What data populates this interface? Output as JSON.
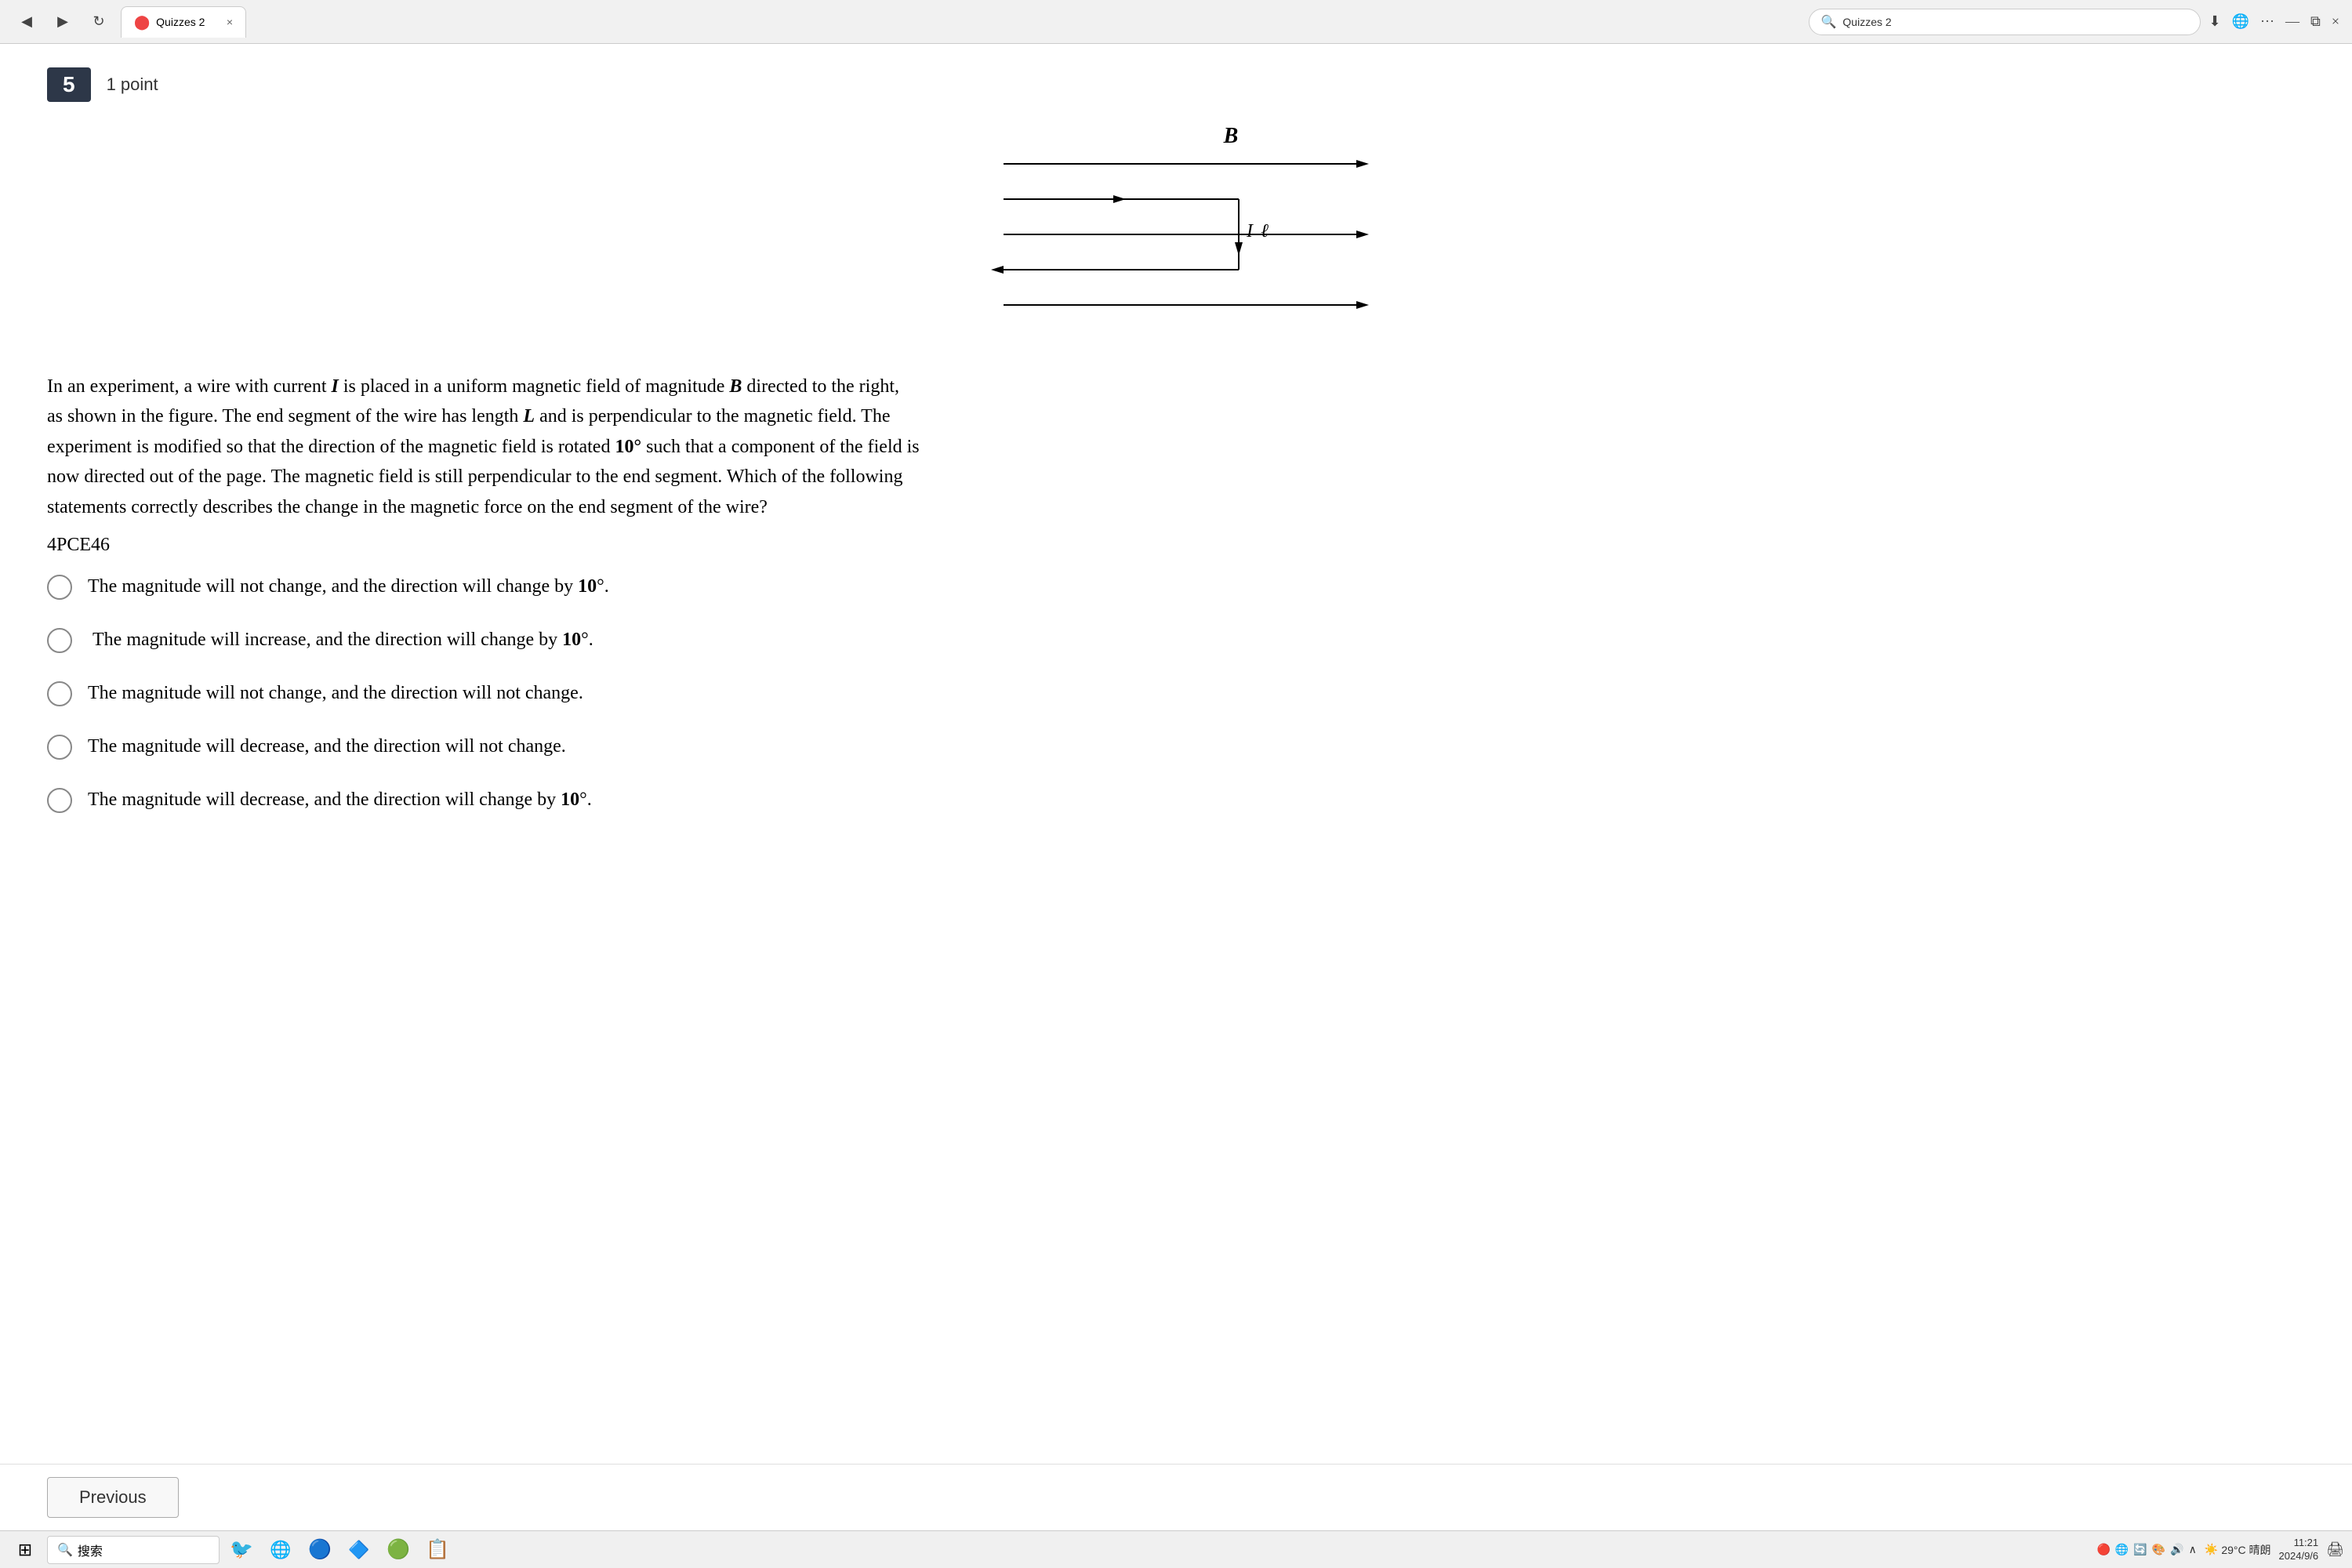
{
  "browser": {
    "back_label": "◀",
    "forward_label": "▶",
    "refresh_label": "↻",
    "tab_title": "Quizzes 2",
    "tab_favicon": "🔴",
    "tab_close": "×",
    "search_url": "Quizzes 2",
    "search_icon": "🔍",
    "right_icons": [
      "⬇",
      "🌐",
      "···",
      "—",
      "⧉",
      "×"
    ]
  },
  "question": {
    "number": "5",
    "points": "1 point",
    "code": "4PCE46",
    "text_line1": "In an experiment, a wire with current ",
    "text_I": "I",
    "text_line1b": " is placed in a uniform magnetic field of magnitude ",
    "text_B": "B",
    "text_line1c": " directed to the right,",
    "text_line2": "as shown in the figure. The end segment of the wire has length ",
    "text_L": "L",
    "text_line2b": " and is perpendicular to the magnetic field. The",
    "text_line3": "experiment is modified so that the direction of the magnetic field is rotated ",
    "text_10a": "10°",
    "text_line3b": " such that a component of the field is",
    "text_line4": "now directed out of the page. The magnetic field is still perpendicular to the end segment. Which of the following",
    "text_line5": "statements correctly describes the change in the magnetic force on the end segment of the wire?"
  },
  "options": [
    {
      "id": "A",
      "text_prefix": "The magnitude will not change, and the direction will change by ",
      "text_bold": "10",
      "text_suffix": "°."
    },
    {
      "id": "B",
      "text_prefix": " The magnitude will increase, and the direction will change by ",
      "text_bold": "10",
      "text_suffix": "°."
    },
    {
      "id": "C",
      "text_prefix": "The magnitude will not change, and the direction will not change.",
      "text_bold": "",
      "text_suffix": ""
    },
    {
      "id": "D",
      "text_prefix": "The magnitude will decrease, and the direction will not change.",
      "text_bold": "",
      "text_suffix": ""
    },
    {
      "id": "E",
      "text_prefix": "The magnitude will decrease, and the direction will change by ",
      "text_bold": "10",
      "text_suffix": "°."
    }
  ],
  "navigation": {
    "previous_label": "Previous"
  },
  "taskbar": {
    "start_icon": "⊞",
    "search_placeholder": "搜索",
    "search_icon": "🔍",
    "apps": [
      "🐦",
      "🌐",
      "🔵",
      "🔷",
      "🟢",
      "📋"
    ],
    "weather": "29°C 晴朗",
    "time": "11:21",
    "date": "2024/9/6",
    "system_icons": [
      "🔴",
      "🌐",
      "🔄",
      "🎨",
      "🔊",
      "🖨"
    ]
  }
}
